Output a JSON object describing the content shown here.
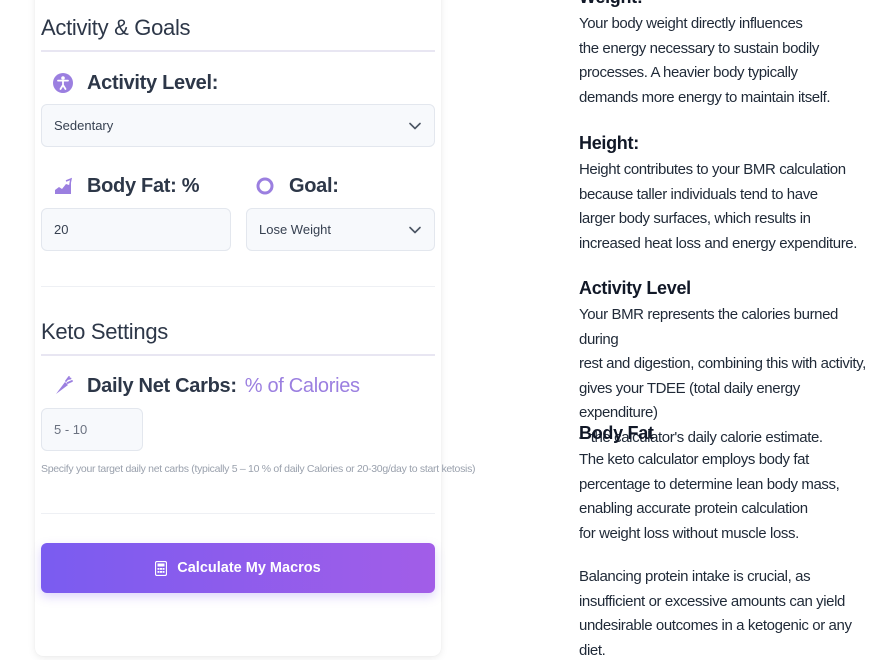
{
  "activity_goals": {
    "title": "Activity & Goals",
    "activity_label": "Activity Level:",
    "activity_value": "Sedentary",
    "bodyfat_label": "Body Fat: %",
    "bodyfat_value": "20",
    "goal_label": "Goal:",
    "goal_value": "Lose Weight"
  },
  "keto": {
    "title": "Keto Settings",
    "carbs_label": "Daily Net Carbs:",
    "carbs_accent": "% of Calories",
    "carbs_placeholder": "5 - 10",
    "hint": "Specify your target daily net carbs (typically 5 – 10 % of daily Calories or 20-30g/day to start ketosis)"
  },
  "button": {
    "label": "Calculate My Macros"
  },
  "info": {
    "weight": {
      "title": "Weight:",
      "lines": [
        "Your body weight directly influences",
        "the energy necessary to sustain bodily",
        "processes. A heavier body typically",
        "demands more energy to maintain itself."
      ]
    },
    "height": {
      "title": "Height:",
      "lines": [
        "Height contributes to your BMR calculation",
        "because taller individuals tend to have",
        "larger body surfaces, which results in",
        "increased heat loss and energy expenditure."
      ]
    },
    "activity": {
      "title": "Activity Level",
      "lines": [
        "Your BMR represents the calories burned during",
        "rest and digestion, combining this with activity,",
        "gives your TDEE (total daily energy expenditure)",
        "– the calculator's daily calorie estimate."
      ]
    },
    "bodyfat": {
      "title": "Body Fat",
      "lines": [
        "The keto calculator employs body fat",
        "percentage to determine lean body mass,",
        "enabling accurate protein calculation",
        "for weight loss without muscle loss."
      ]
    },
    "balance": {
      "lines": [
        "Balancing protein intake is crucial, as",
        "insufficient or excessive amounts can yield",
        "undesirable outcomes in a ketogenic or any diet."
      ]
    }
  },
  "colors": {
    "accent": "#9b7fe0",
    "button_start": "#7a5cf0",
    "button_end": "#a25de8"
  },
  "icons": [
    "accessibility-icon",
    "weight-chart-icon",
    "goal-ring-icon",
    "carrot-icon",
    "calculator-icon",
    "chevron-down-icon"
  ]
}
